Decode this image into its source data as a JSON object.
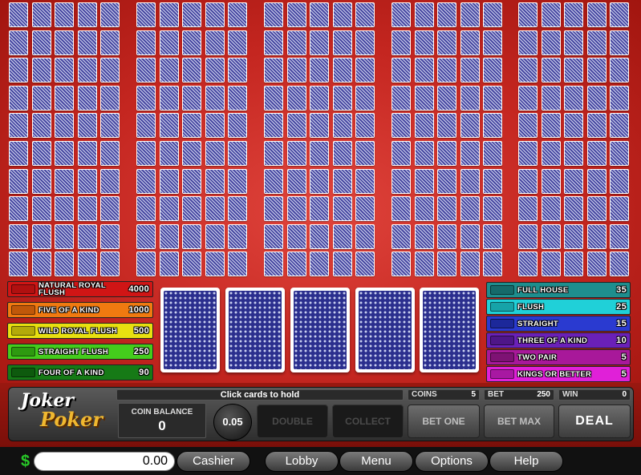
{
  "game": {
    "logo_line1": "Joker",
    "logo_line2": "Poker"
  },
  "paytable_left": [
    {
      "name": "NATURAL ROYAL FLUSH",
      "payout": "4000",
      "color": "#d01515",
      "swatch": "#b01010"
    },
    {
      "name": "FIVE OF A KIND",
      "payout": "1000",
      "color": "#f07a10",
      "swatch": "#c0580a"
    },
    {
      "name": "WILD ROYAL FLUSH",
      "payout": "500",
      "color": "#e8e010",
      "swatch": "#b3aa0a"
    },
    {
      "name": "STRAIGHT FLUSH",
      "payout": "250",
      "color": "#44cc1c",
      "swatch": "#2e9a10"
    },
    {
      "name": "FOUR OF A KIND",
      "payout": "90",
      "color": "#167a16",
      "swatch": "#0e5a0e"
    }
  ],
  "paytable_right": [
    {
      "name": "FULL HOUSE",
      "payout": "35",
      "color": "#1e8e8e",
      "swatch": "#156a6a"
    },
    {
      "name": "FLUSH",
      "payout": "25",
      "color": "#20d0d8",
      "swatch": "#16a3a8"
    },
    {
      "name": "STRAIGHT",
      "payout": "15",
      "color": "#2a3ad0",
      "swatch": "#1c289a"
    },
    {
      "name": "THREE OF A KIND",
      "payout": "10",
      "color": "#6a20b8",
      "swatch": "#4e1688"
    },
    {
      "name": "TWO PAIR",
      "payout": "5",
      "color": "#a8189a",
      "swatch": "#7e1274"
    },
    {
      "name": "KINGS OR BETTER",
      "payout": "5",
      "color": "#e020d8",
      "swatch": "#a818a2"
    }
  ],
  "mini_hands": {
    "columns": 5,
    "rows": 10,
    "cards_per_hand": 5
  },
  "main_cards": [
    1,
    2,
    3,
    4,
    5
  ],
  "status": {
    "message": "Click cards to hold"
  },
  "coin_balance": {
    "label": "COIN BALANCE",
    "value": "0"
  },
  "denomination": "0.05",
  "coins": {
    "label": "COINS",
    "value": "5"
  },
  "bet": {
    "label": "BET",
    "value": "250"
  },
  "win": {
    "label": "WIN",
    "value": "0"
  },
  "buttons": {
    "double": "DOUBLE",
    "collect": "COLLECT",
    "bet_one": "BET ONE",
    "bet_max": "BET MAX",
    "deal": "DEAL"
  },
  "bottom": {
    "currency_symbol": "$",
    "balance": "0.00",
    "cashier": "Cashier",
    "lobby": "Lobby",
    "menu": "Menu",
    "options": "Options",
    "help": "Help"
  }
}
